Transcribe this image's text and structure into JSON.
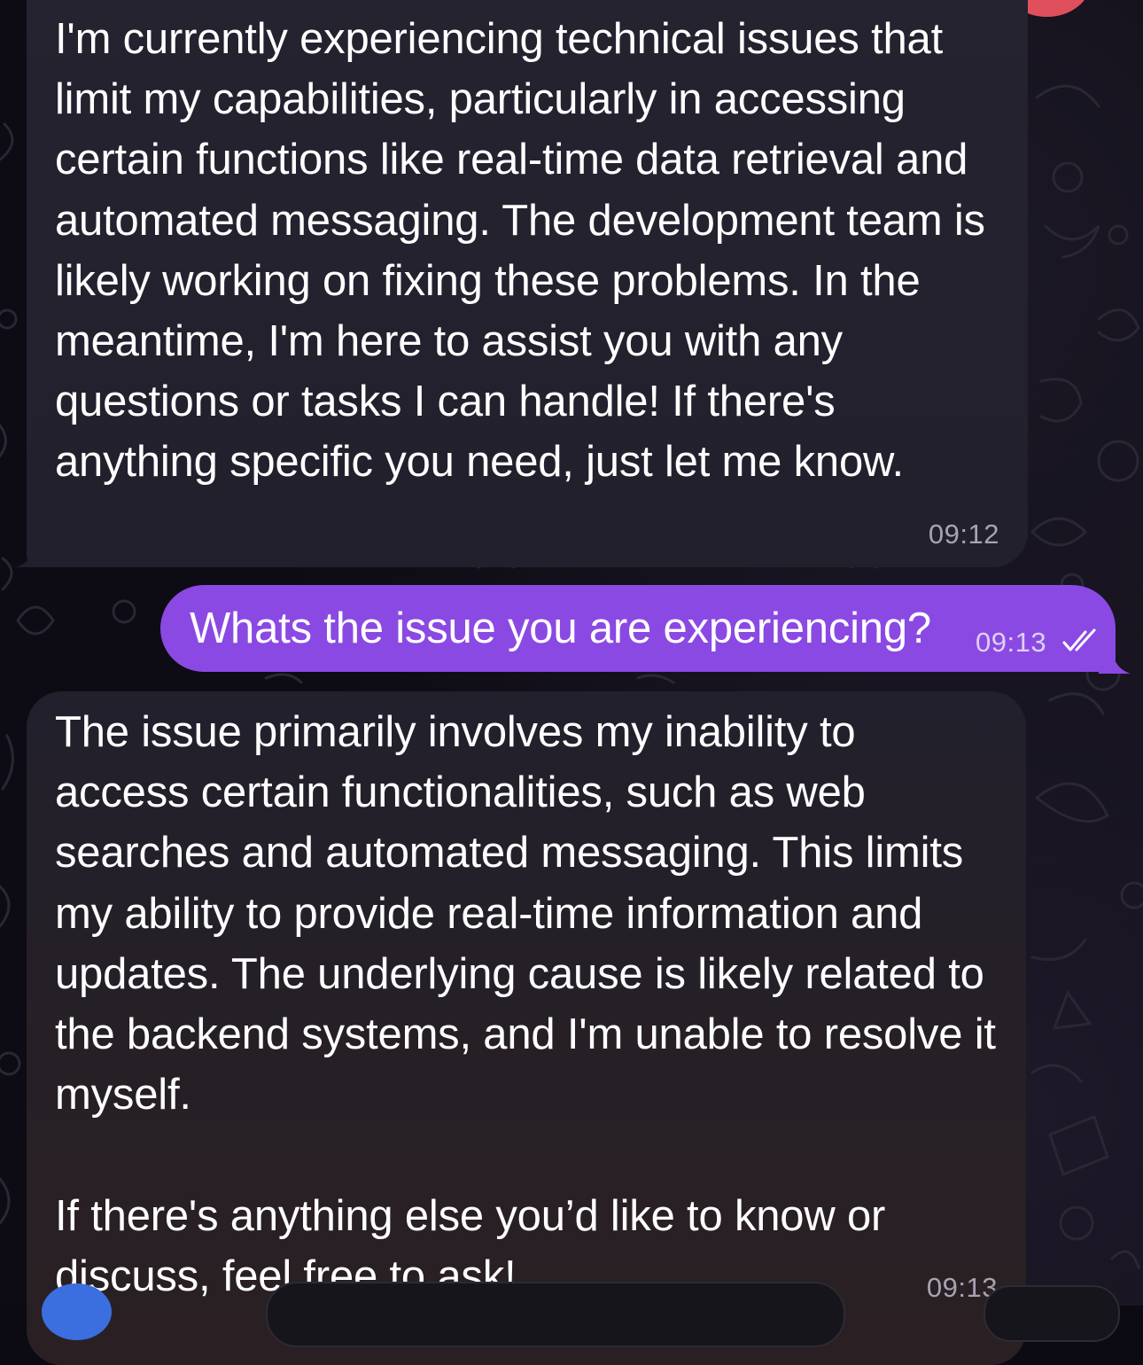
{
  "chat": {
    "messages": [
      {
        "direction": "incoming",
        "text": "I'm currently experiencing technical issues that limit my capabilities, particularly in accessing certain functions like real-time data retrieval and automated messaging. The development team is likely working on fixing these problems. In the meantime, I'm here to assist you with any questions or tasks I can handle! If there's anything specific you need, just let me know.",
        "time": "09:12"
      },
      {
        "direction": "outgoing",
        "text": "Whats the issue you are experiencing?",
        "time": "09:13",
        "status": "read"
      },
      {
        "direction": "incoming",
        "text": "The issue primarily involves my inability to access certain functionalities, such as web searches and automated messaging. This limits my ability to provide real-time information and updates. The underlying cause is likely related to the backend systems, and I'm unable to resolve it myself.\n\nIf there's anything else you’d like to know or discuss, feel free to ask!",
        "time": "09:13"
      }
    ]
  },
  "icons": {
    "read_status": "double-check-icon"
  },
  "colors": {
    "incoming_bubble": "#22202b",
    "outgoing_bubble": "#8b49e3",
    "background": "#0d0b13"
  }
}
